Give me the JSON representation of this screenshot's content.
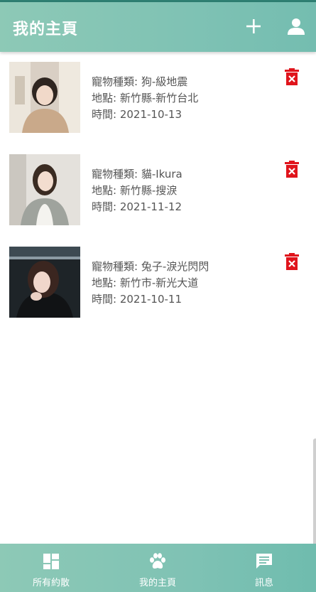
{
  "app": {
    "title": "我的主頁",
    "accent_color": "#7fc2b4",
    "icons": {
      "add": "plus-icon",
      "user": "person-icon"
    }
  },
  "posts": [
    {
      "species": "寵物種類: 狗-級地震",
      "location": "地點: 新竹縣-新竹台北",
      "time": "時間: 2021-10-13",
      "photo_icon": "pet-photo"
    },
    {
      "species": "寵物種類: 貓-Ikura",
      "location": "地點: 新竹縣-搜淚",
      "time": "時間: 2021-11-12",
      "photo_icon": "pet-photo"
    },
    {
      "species": "寵物種類: 兔子-淚光閃閃",
      "location": "地點: 新竹市-新光大道",
      "time": "時間: 2021-10-11",
      "photo_icon": "pet-photo"
    }
  ],
  "delete_icon": "trash-delete-icon",
  "delete_color": "#e0141c",
  "nav": {
    "tabs": [
      {
        "label": "所有約散",
        "icon": "dashboard-icon"
      },
      {
        "label": "我的主頁",
        "icon": "paw-icon"
      },
      {
        "label": "訊息",
        "icon": "chat-icon"
      }
    ]
  }
}
